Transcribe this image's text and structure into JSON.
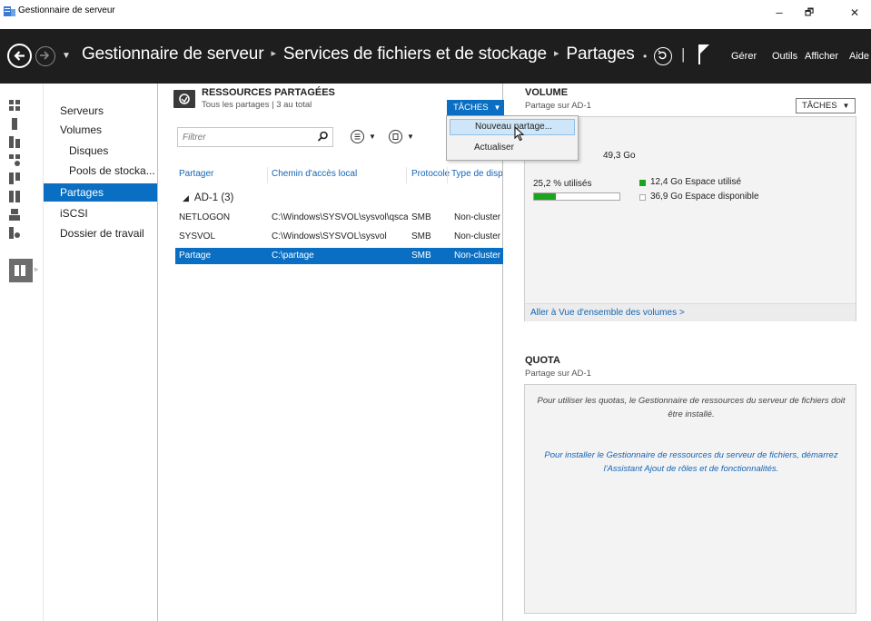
{
  "window": {
    "title": "Gestionnaire de serveur",
    "minimize": "–",
    "maximize": "🗗",
    "close": "✕"
  },
  "header": {
    "breadcrumb": [
      "Gestionnaire de serveur",
      "Services de fichiers et de stockage",
      "Partages"
    ],
    "separator": "▸",
    "menu": [
      "Gérer",
      "Outils",
      "Afficher",
      "Aide"
    ]
  },
  "nav": {
    "items": [
      {
        "label": "Serveurs"
      },
      {
        "label": "Volumes"
      },
      {
        "label": "Disques"
      },
      {
        "label": "Pools de stocka..."
      },
      {
        "label": "Partages"
      },
      {
        "label": "iSCSI"
      },
      {
        "label": "Dossier de travail"
      }
    ]
  },
  "shares": {
    "title": "RESSOURCES PARTAGÉES",
    "subtitle": "Tous les partages | 3 au total",
    "tasks_label": "TÂCHES",
    "filter_placeholder": "Filtrer",
    "columns": [
      "Partager",
      "Chemin d'accès local",
      "Protocole",
      "Type de dispo"
    ],
    "group": "AD-1 (3)",
    "rows": [
      {
        "name": "NETLOGON",
        "path": "C:\\Windows\\SYSVOL\\sysvol\\qscar...",
        "protocol": "SMB",
        "type": "Non-cluster"
      },
      {
        "name": "SYSVOL",
        "path": "C:\\Windows\\SYSVOL\\sysvol",
        "protocol": "SMB",
        "type": "Non-cluster"
      },
      {
        "name": "Partage",
        "path": "C:\\partage",
        "protocol": "SMB",
        "type": "Non-cluster"
      }
    ],
    "dropdown": [
      "Nouveau partage...",
      "Actualiser"
    ]
  },
  "volume": {
    "title": "VOLUME",
    "subtitle": "Partage sur AD-1",
    "tasks_label": "TÂCHES",
    "size": "49,3 Go",
    "used_pct_label": "25,2 % utilisés",
    "used_fraction": 0.252,
    "legend_used": "12,4 Go Espace utilisé",
    "legend_free": "36,9 Go Espace disponible",
    "link": "Aller à Vue d'ensemble des volumes >",
    "used_color": "#1ca51c"
  },
  "quota": {
    "title": "QUOTA",
    "subtitle": "Partage sur AD-1",
    "message": "Pour utiliser les quotas, le Gestionnaire de ressources du serveur de fichiers doit être installé.",
    "install_link": "Pour installer le Gestionnaire de ressources du serveur de fichiers, démarrez l'Assistant Ajout de rôles et de fonctionnalités."
  },
  "colors": {
    "accent": "#0a6fc2",
    "header_bg": "#1e1e1e",
    "link": "#1565b8"
  }
}
